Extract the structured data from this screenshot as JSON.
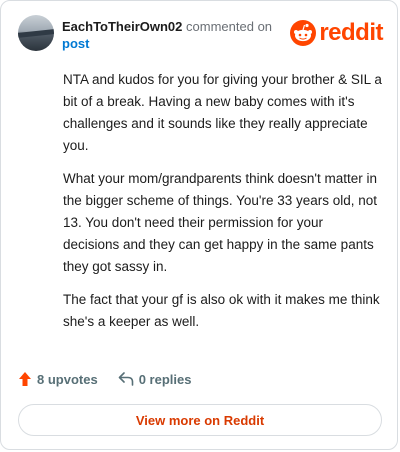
{
  "comment": {
    "username": "EachToTheirOwn02",
    "commented_on_text": "commented on",
    "post_link_text": "post",
    "paragraphs": [
      "NTA and kudos for you for giving your brother & SIL a bit of a break. Having a new baby comes with it's challenges and it sounds like they really appreciate you.",
      "What your mom/grandparents think doesn't matter in the bigger scheme of things. You're 33 years old, not 13. You don't need their permission for your decisions and they can get happy in the same pants they got sassy in.",
      "The fact that your gf is also ok with it makes me think she's a keeper as well."
    ],
    "upvotes_label": "8 upvotes",
    "replies_label": "0 replies",
    "view_more_label": "View more on Reddit"
  },
  "brand": {
    "wordmark": "reddit",
    "color": "#ff4500"
  },
  "icons": {
    "avatar": "avatar-image",
    "logo": "reddit-snoo-icon",
    "upvote": "upvote-arrow-icon",
    "reply": "reply-arrow-icon"
  },
  "colors": {
    "link": "#0079d3",
    "upvote": "#ff4500",
    "view_more_text": "#d93a00",
    "muted": "#576f76"
  }
}
